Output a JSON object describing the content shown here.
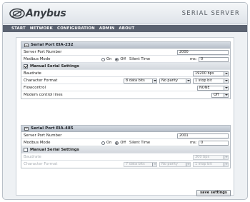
{
  "header": {
    "logo_text": "Anybus",
    "product_title": "SERIAL SERVER"
  },
  "nav": {
    "items": [
      "START",
      "NETWORK",
      "CONFIGURATION",
      "ADMIN",
      "ABOUT"
    ]
  },
  "port1": {
    "title": "Serial Port EIA-232",
    "server_port_label": "Server Port Number",
    "server_port_value": "2000",
    "modbus_label": "Modbus Mode",
    "on_label": "On",
    "off_label": "Off",
    "modbus_selected": "Off",
    "silent_label": "Silent Time",
    "ms_label": "ms:",
    "silent_value": "0",
    "manual_label": "Manual Serial Settings",
    "manual_checked": true,
    "baud_label": "Baudrate",
    "baud_value": "19200 bps",
    "char_label": "Character Format",
    "data_bits": "8 data bits",
    "parity": "No parity",
    "stop_bits": "1 stop bit",
    "flow_label": "Flowcontrol",
    "flow_value": "NONE",
    "modem_label": "Modem control lines",
    "modem_value": "Off"
  },
  "port2": {
    "title": "Serial Port EIA-485",
    "server_port_label": "Server Port Number",
    "server_port_value": "2001",
    "modbus_label": "Modbus Mode",
    "on_label": "On",
    "off_label": "Off",
    "modbus_selected": "Off",
    "silent_label": "Silent Time",
    "ms_label": "ms:",
    "silent_value": "0",
    "manual_label": "Manual Serial Settings",
    "manual_checked": false,
    "baud_label": "Baudrate",
    "baud_value": "300 bps",
    "char_label": "Character Format",
    "data_bits": "7 data bits",
    "parity": "No parity",
    "stop_bits": "1 stop bit"
  },
  "actions": {
    "save_label": "save settings"
  },
  "colors": {
    "nav_bg": "#5a6270",
    "section_header_bg": "#c5ccd5",
    "frame_bg": "#eef1f4"
  }
}
